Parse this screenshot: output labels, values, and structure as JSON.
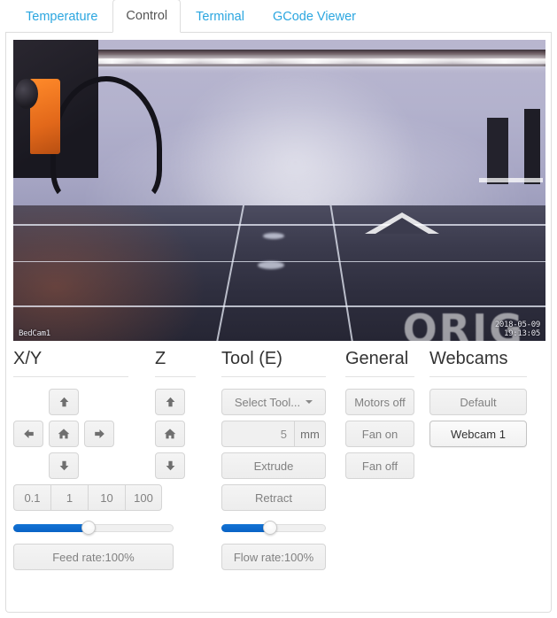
{
  "tabs": [
    {
      "label": "Temperature",
      "active": false
    },
    {
      "label": "Control",
      "active": true
    },
    {
      "label": "Terminal",
      "active": false
    },
    {
      "label": "GCode Viewer",
      "active": false
    }
  ],
  "webcam": {
    "stream_label": "BedCam1",
    "timestamp_date": "2018-05-09",
    "timestamp_time": "19:13:05",
    "bed_brand_text": "ORIG"
  },
  "controls": {
    "xy": {
      "heading": "X/Y",
      "up_icon": "arrow-up-icon",
      "left_icon": "arrow-left-icon",
      "home_icon": "home-icon",
      "right_icon": "arrow-right-icon",
      "down_icon": "arrow-down-icon",
      "steps": [
        "0.1",
        "1",
        "10",
        "100"
      ],
      "feedrate_slider_percent": 47,
      "feedrate_label": "Feed rate:100%"
    },
    "z": {
      "heading": "Z",
      "up_icon": "arrow-up-icon",
      "home_icon": "home-icon",
      "down_icon": "arrow-down-icon"
    },
    "tool": {
      "heading": "Tool (E)",
      "select_tool_label": "Select Tool...",
      "amount_value": "5",
      "amount_unit": "mm",
      "extrude_label": "Extrude",
      "retract_label": "Retract",
      "flowrate_slider_percent": 47,
      "flowrate_label": "Flow rate:100%"
    },
    "general": {
      "heading": "General",
      "motors_off_label": "Motors off",
      "fan_on_label": "Fan on",
      "fan_off_label": "Fan off"
    },
    "webcams": {
      "heading": "Webcams",
      "buttons": [
        {
          "label": "Default",
          "active": false
        },
        {
          "label": "Webcam 1",
          "active": true
        }
      ]
    }
  },
  "colors": {
    "tab_link": "#2ba6e0",
    "slider_fill": "#0d6ccb",
    "heading": "#333333",
    "button_text": "#818181"
  }
}
